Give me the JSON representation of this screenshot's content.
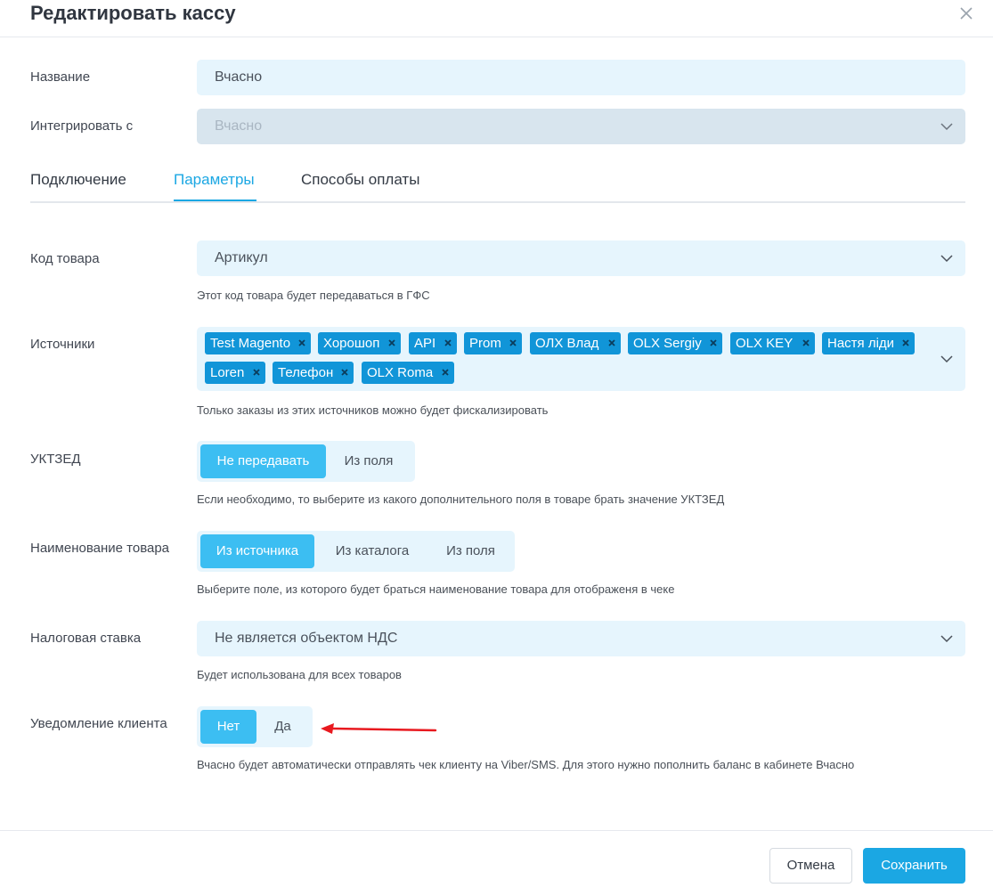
{
  "modal": {
    "title": "Редактировать кассу"
  },
  "fields": {
    "name": {
      "label": "Название",
      "value": "Вчасно"
    },
    "integrate": {
      "label": "Интегрировать с",
      "value": "Вчасно"
    }
  },
  "tabs": [
    {
      "label": "Подключение"
    },
    {
      "label": "Параметры"
    },
    {
      "label": "Способы оплаты"
    }
  ],
  "active_tab": "Параметры",
  "params": {
    "product_code": {
      "label": "Код товара",
      "value": "Артикул",
      "hint": "Этот код товара будет передаваться в ГФС"
    },
    "sources": {
      "label": "Источники",
      "tags": [
        "Test Magento",
        "Хорошоп",
        "API",
        "Prom",
        "ОЛХ Влад",
        "OLX Sergiy",
        "OLX KEY",
        "Настя ліди",
        "Loren",
        "Телефон",
        "OLX Roma"
      ],
      "hint": "Только заказы из этих источников можно будет фискализировать"
    },
    "uktzed": {
      "label": "УКТЗЕД",
      "options": [
        "Не передавать",
        "Из поля"
      ],
      "selected": "Не передавать",
      "hint": "Если необходимо, то выберите из какого дополнительного поля в товаре брать значение УКТЗЕД"
    },
    "product_name": {
      "label": "Наименование товара",
      "options": [
        "Из источника",
        "Из каталога",
        "Из поля"
      ],
      "selected": "Из источника",
      "hint": "Выберите поле, из которого будет браться наименование товара для отображеня в чеке"
    },
    "tax_rate": {
      "label": "Налоговая ставка",
      "value": "Не является объектом НДС",
      "hint": "Будет использована для всех товаров"
    },
    "client_notify": {
      "label": "Уведомление клиента",
      "options": [
        "Нет",
        "Да"
      ],
      "selected": "Нет",
      "hint": "Вчасно будет автоматически отправлять чек клиенту на Viber/SMS. Для этого нужно пополнить баланс в кабинете Вчасно"
    }
  },
  "footer": {
    "cancel_label": "Отмена",
    "save_label": "Сохранить"
  },
  "colors": {
    "accent": "#1ba7e3",
    "segment_active": "#3cbef2",
    "tag_bg": "#1195d8",
    "field_bg": "#e6f5fd",
    "annotation_arrow": "#e8191f"
  }
}
